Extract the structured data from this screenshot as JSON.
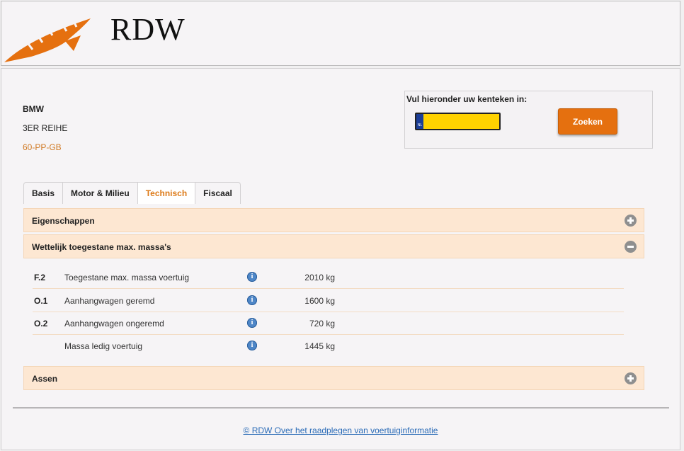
{
  "header": {
    "logo_text": "RDW"
  },
  "vehicle": {
    "make": "BMW",
    "model": "3ER REIHE",
    "plate": "60-PP-GB"
  },
  "search": {
    "label": "Vul hieronder uw kenteken in:",
    "input_value": "",
    "plate_country": "NL",
    "button_label": "Zoeken"
  },
  "tabs": [
    {
      "label": "Basis",
      "active": false
    },
    {
      "label": "Motor & Milieu",
      "active": false
    },
    {
      "label": "Technisch",
      "active": true
    },
    {
      "label": "Fiscaal",
      "active": false
    }
  ],
  "sections": {
    "eigenschappen": {
      "title": "Eigenschappen",
      "icon": "plus-circle-icon"
    },
    "massas": {
      "title": "Wettelijk toegestane max. massa's",
      "icon": "minus-circle-icon"
    },
    "assen": {
      "title": "Assen",
      "icon": "plus-circle-icon"
    }
  },
  "mass_rows": [
    {
      "code": "F.2",
      "label": "Toegestane max. massa voertuig",
      "value": "2010 kg"
    },
    {
      "code": "O.1",
      "label": "Aanhangwagen geremd",
      "value": "1600 kg"
    },
    {
      "code": "O.2",
      "label": "Aanhangwagen ongeremd",
      "value": "720 kg"
    },
    {
      "code": "",
      "label": "Massa ledig voertuig",
      "value": "1445 kg"
    }
  ],
  "footer": {
    "link_text": "© RDW  Over het raadplegen van voertuiginformatie"
  },
  "colors": {
    "accent": "#e5700f",
    "accordion_bg": "#fde7d2",
    "plate_yellow": "#ffd200",
    "link": "#2a6bb7"
  }
}
